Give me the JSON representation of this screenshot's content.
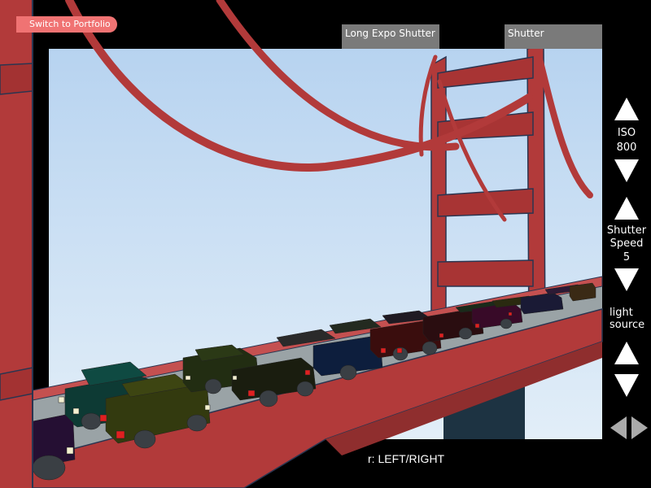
{
  "portfolio_link": "Switch to Portfolio",
  "toolbar": {
    "long_expo_label": "Long Expo Shutter",
    "shutter_label": "Shutter"
  },
  "controls": {
    "iso": {
      "label": "ISO",
      "value": "800"
    },
    "shutter_speed": {
      "label_line1": "Shutter",
      "label_line2": "Speed",
      "value": "5"
    },
    "light_source": {
      "label_line1": "light",
      "label_line2": "source"
    }
  },
  "hint": "r: LEFT/RIGHT",
  "colors": {
    "sky_top": "#b7d3f0",
    "sky_bottom": "#dcebf7",
    "bridge_red": "#b23a3a",
    "bridge_dark": "#8f2e2e",
    "road_gray": "#a7b0b3",
    "button_gray": "#7a7a7a",
    "portfolio_pink": "#f07373"
  },
  "icons": [
    "triangle-up-icon",
    "triangle-down-icon",
    "triangle-left-icon",
    "triangle-right-icon"
  ]
}
